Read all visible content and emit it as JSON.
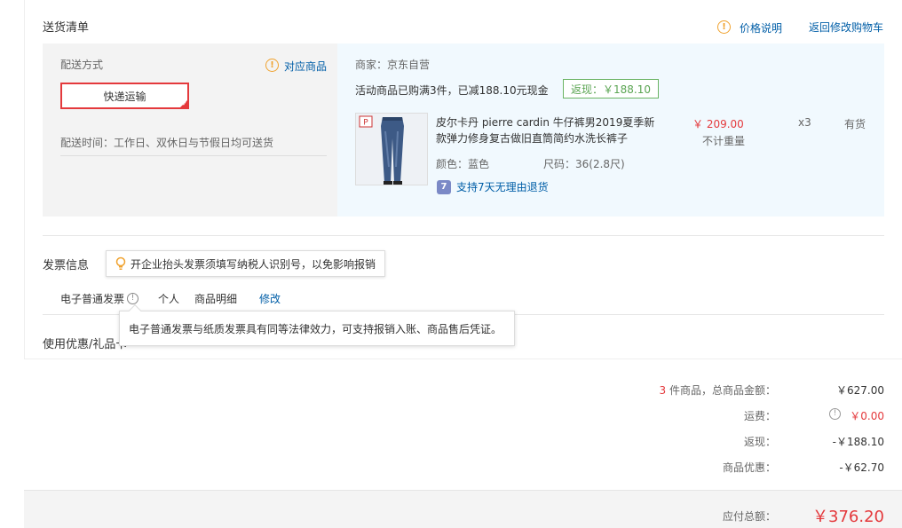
{
  "header": {
    "title": "送货清单",
    "price_note": "价格说明",
    "back_to_cart": "返回修改购物车"
  },
  "shipping": {
    "method_label": "配送方式",
    "corresponding_goods": "对应商品",
    "selected_method": "快递运输",
    "delivery_time": "配送时间：工作日、双休日与节假日均可送货"
  },
  "order": {
    "merchant": "商家：京东自营",
    "promo_text": "活动商品已购满3件，已减188.10元现金",
    "cashback_tag": "返现：￥188.10",
    "product": {
      "title_line1": "皮尔卡丹 pierre cardin 牛仔裤男2019夏季新",
      "title_line2": "款弹力修身复古做旧直筒简约水洗长裤子",
      "color": "颜色：蓝色",
      "size": "尺码：36(2.8尺)",
      "return_policy": "支持7天无理由退货",
      "price": "￥ 209.00",
      "weight": "不计重量",
      "quantity": "x3",
      "stock": "有货",
      "brand_logo_text": "P"
    }
  },
  "invoice": {
    "title": "发票信息",
    "tip": "开企业抬头发票须填写纳税人识别号，以免影响报销",
    "type": "电子普通发票",
    "info_icon": "!",
    "holder": "个人",
    "content": "商品明细",
    "edit": "修改",
    "popup": "电子普通发票与纸质发票具有同等法律效力，可支持报销入账、商品售后凭证。"
  },
  "coupon": {
    "title": "使用优惠/礼品卡"
  },
  "totals": {
    "count": "3",
    "count_label": "件商品，总商品金额：",
    "goods_amount": "￥627.00",
    "freight_label": "运费：",
    "freight": "￥0.00",
    "cashback_label": "返现：",
    "cashback": "-￥188.10",
    "discount_label": "商品优惠：",
    "discount": "-￥62.70",
    "payable_label": "应付总额：",
    "payable": "￥376.20"
  },
  "colors": {
    "accent_red": "#e4393c",
    "link_blue": "#005ea7",
    "cashback_green": "#5ba553",
    "warn_orange": "#f0a22e"
  }
}
